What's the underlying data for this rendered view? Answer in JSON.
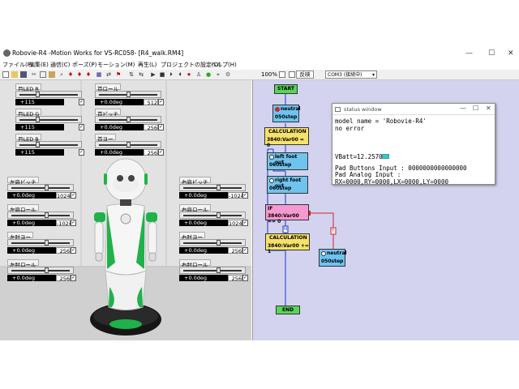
{
  "window": {
    "title": "Robovie-R4 -Motion Works for VS-RC058-  [R4_walk.RM4]",
    "minimize": "—",
    "maximize": "☐",
    "close": "✕"
  },
  "menu": [
    "ファイル(F)",
    "編集(E)",
    "通信(C)",
    "ポーズ(P)",
    "モーション(M)",
    "再生(L)",
    "プロジェクトの設定(D)",
    "ヘルプ(H)"
  ],
  "toolbar": {
    "zoom": "100%",
    "reverse": "反映",
    "port": "COM3 (接続中)"
  },
  "sliders": [
    {
      "label": "目LED R",
      "value": "+115",
      "num": "",
      "dir": "ltr",
      "knob": 0.3
    },
    {
      "label": "目LED G",
      "value": "+115",
      "num": "",
      "dir": "ltr",
      "knob": 0.3
    },
    {
      "label": "目LED B",
      "value": "+115",
      "num": "",
      "dir": "ltr",
      "knob": 0.3
    },
    {
      "label": "首ロール",
      "value": "+0.0deg",
      "num": "512",
      "dir": "ltr",
      "knob": 0.5
    },
    {
      "label": "首ピッチ",
      "value": "+0.0deg",
      "num": "256",
      "dir": "ltr",
      "knob": 0.5
    },
    {
      "label": "首ヨー",
      "value": "+0.0deg",
      "num": "256",
      "dir": "ltr",
      "knob": 0.5
    },
    {
      "label": "左肩ピッチ",
      "value": "+0.0deg",
      "num": "1024",
      "dir": "ltr",
      "knob": 0.6
    },
    {
      "label": "左肩ロール",
      "value": "+0.0deg",
      "num": "-1024",
      "dir": "ltr",
      "knob": 0.6
    },
    {
      "label": "左肘ヨー",
      "value": "+0.0deg",
      "num": "256",
      "dir": "ltr",
      "knob": 0.6
    },
    {
      "label": "左肘ロール",
      "value": "+0.0deg",
      "num": "256",
      "dir": "ltr",
      "knob": 0.6
    },
    {
      "label": "右肩ピッチ",
      "value": "+0.0deg",
      "num": "-1024",
      "dir": "ltr",
      "knob": 0.6
    },
    {
      "label": "右肩ロール",
      "value": "+0.0deg",
      "num": "1024",
      "dir": "ltr",
      "knob": 0.6
    },
    {
      "label": "右肘ヨー",
      "value": "+0.0deg",
      "num": "256",
      "dir": "ltr",
      "knob": 0.6
    },
    {
      "label": "右肘ロール",
      "value": "+0.0deg",
      "num": "256",
      "dir": "ltr",
      "knob": 0.6
    }
  ],
  "flow": {
    "start": "START",
    "neutral1_title": "neutral",
    "neutral1_step": "050step",
    "calc1_title": "CALCULATION",
    "calc1_expr": "3840:Var00 = 0",
    "left_title": "left foot out",
    "left_step": "060step",
    "right_title": "right foot out",
    "right_step": "060step",
    "if_label": "IF",
    "if_expr": "3840:Var00 == 0",
    "n_label": "N",
    "y_label": "Y",
    "calc2_title": "CALCULATION",
    "calc2_expr": "3840:Var00 += 1",
    "neutral2_title": "neutral",
    "neutral2_step": "050step",
    "end": "END"
  },
  "status": {
    "title": "status window",
    "lines": [
      "model name = 'Robovie-R4'",
      "no error",
      "VBatt=12.2570V",
      "Pad Buttons Input : 0000000000000000",
      "Pad Analog Input : RX=0000,RY=0000,LX=0000,LY=0000"
    ]
  }
}
